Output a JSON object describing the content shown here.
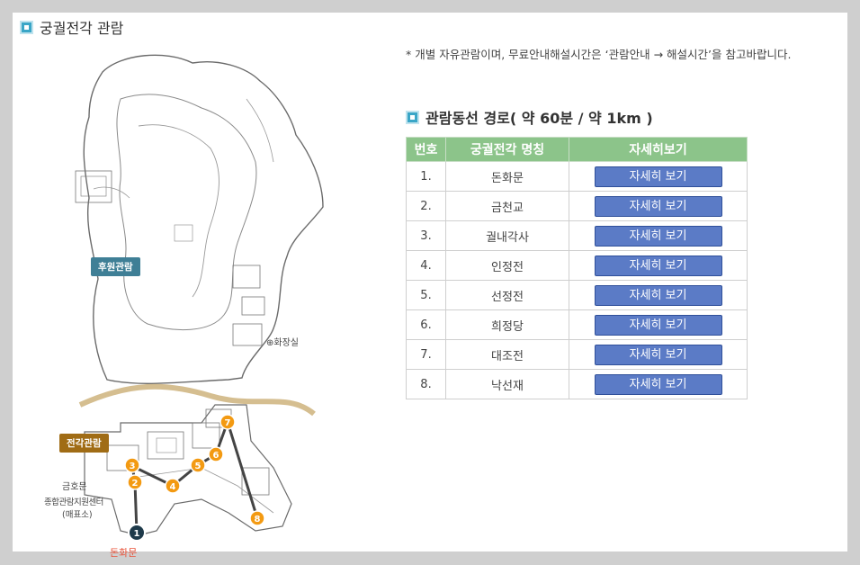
{
  "title": "궁궐전각 관람",
  "notice": "* 개별 자유관람이며, 무료안내해설시간은 ‘관람안내 → 해설시간’을 참고바랍니다.",
  "route_title": "관람동선 경로( 약 60분 / 약 1km )",
  "table": {
    "headers": [
      "번호",
      "궁궐전각 명칭",
      "자세히보기"
    ],
    "rows": [
      {
        "num": "1.",
        "name": "돈화문",
        "btn": "자세히 보기"
      },
      {
        "num": "2.",
        "name": "금천교",
        "btn": "자세히 보기"
      },
      {
        "num": "3.",
        "name": "궐내각사",
        "btn": "자세히 보기"
      },
      {
        "num": "4.",
        "name": "인정전",
        "btn": "자세히 보기"
      },
      {
        "num": "5.",
        "name": "선정전",
        "btn": "자세히 보기"
      },
      {
        "num": "6.",
        "name": "희정당",
        "btn": "자세히 보기"
      },
      {
        "num": "7.",
        "name": "대조전",
        "btn": "자세히 보기"
      },
      {
        "num": "8.",
        "name": "낙선재",
        "btn": "자세히 보기"
      }
    ]
  },
  "map": {
    "tag_garden": "후원관람",
    "tag_hall": "전각관람",
    "restroom": "화장실",
    "geumhomun": "금호문",
    "center_line1": "종합관람지원센터",
    "center_line2": "(매표소)",
    "donhwamun": "돈화문",
    "markers": [
      "1",
      "2",
      "3",
      "4",
      "5",
      "6",
      "7",
      "8"
    ]
  },
  "colors": {
    "accent": "#3aa6c7",
    "table_header": "#8cc48a",
    "button": "#5b7bc6",
    "marker": "#f39a12",
    "start_marker": "#1e3a4a",
    "entrance_text": "#e8533a"
  }
}
